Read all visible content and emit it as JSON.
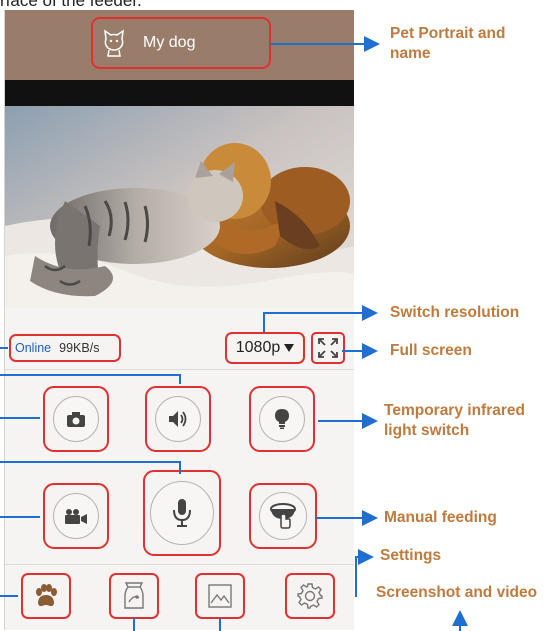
{
  "page_text": "rface of the feeder.",
  "app": {
    "pet_name": "My dog",
    "status": {
      "online": "Online",
      "speed": "99KB/s"
    },
    "resolution": "1080p"
  },
  "callouts": {
    "pet_portrait": "Pet Portrait and name",
    "switch_resolution": "Switch resolution",
    "full_screen": "Full screen",
    "infrared": "Temporary infrared light switch",
    "manual_feeding": "Manual feeding",
    "settings": "Settings",
    "screenshot_video": "Screenshot and video"
  },
  "icons": [
    "cat-avatar-icon",
    "camera-icon",
    "speaker-icon",
    "bulb-icon",
    "video-camera-icon",
    "microphone-icon",
    "feeder-bowl-icon",
    "paw-icon",
    "food-bag-icon",
    "gallery-icon",
    "gear-icon",
    "expand-icon"
  ],
  "colors": {
    "header": "#997d6a",
    "highlight": "#e03030",
    "callout": "#c07a3d",
    "online": "#1f5fbf"
  }
}
